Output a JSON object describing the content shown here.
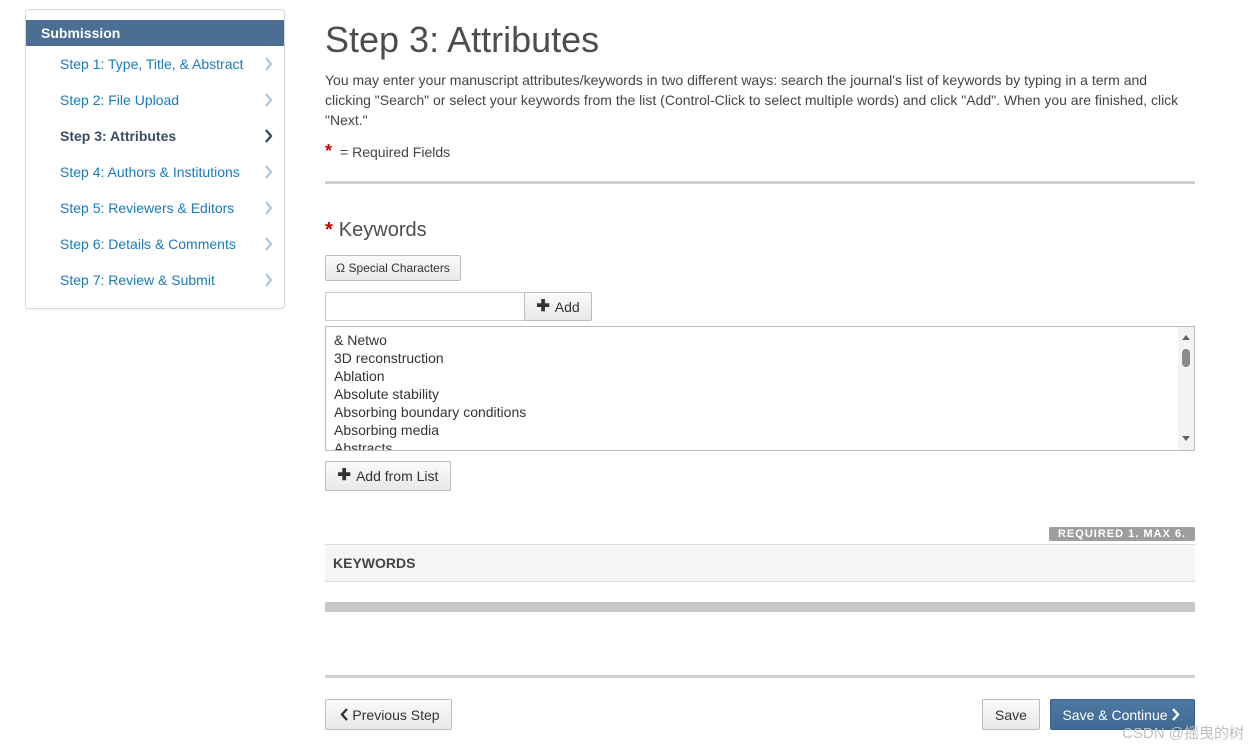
{
  "sidebar": {
    "header": "Submission",
    "items": [
      {
        "label": "Step 1: Type, Title, & Abstract",
        "active": false
      },
      {
        "label": "Step 2: File Upload",
        "active": false
      },
      {
        "label": "Step 3: Attributes",
        "active": true
      },
      {
        "label": "Step 4: Authors & Institutions",
        "active": false
      },
      {
        "label": "Step 5: Reviewers & Editors",
        "active": false
      },
      {
        "label": "Step 6: Details & Comments",
        "active": false
      },
      {
        "label": "Step 7: Review & Submit",
        "active": false
      }
    ]
  },
  "main": {
    "title": "Step 3: Attributes",
    "intro": "You may enter your manuscript attributes/keywords in two different ways: search the journal's list of keywords by typing in a term and clicking \"Search\" or select your keywords from the list (Control-Click to select multiple words) and click \"Add\". When you are finished, click \"Next.\"",
    "required_star": "*",
    "required_note": "= Required Fields"
  },
  "keywords": {
    "title": "Keywords",
    "special_chars_label": "Ω Special Characters",
    "input_value": "",
    "add_label": "Add",
    "options": [
      "& Netwo",
      "3D reconstruction",
      "Ablation",
      "Absolute stability",
      "Absorbing boundary conditions",
      "Absorbing media",
      "Abstracts"
    ],
    "add_from_list_label": "Add from List",
    "limit_badge": "REQUIRED 1. MAX 6.",
    "table_header": "KEYWORDS"
  },
  "footer": {
    "previous_label": "Previous Step",
    "save_label": "Save",
    "continue_label": "Save & Continue"
  },
  "watermark": "CSDN @摇曳的树",
  "colors": {
    "sidebar_header": "#4a6f93",
    "link": "#1a7bb9",
    "required": "#cc0000",
    "primary_button": "#4572a0"
  }
}
